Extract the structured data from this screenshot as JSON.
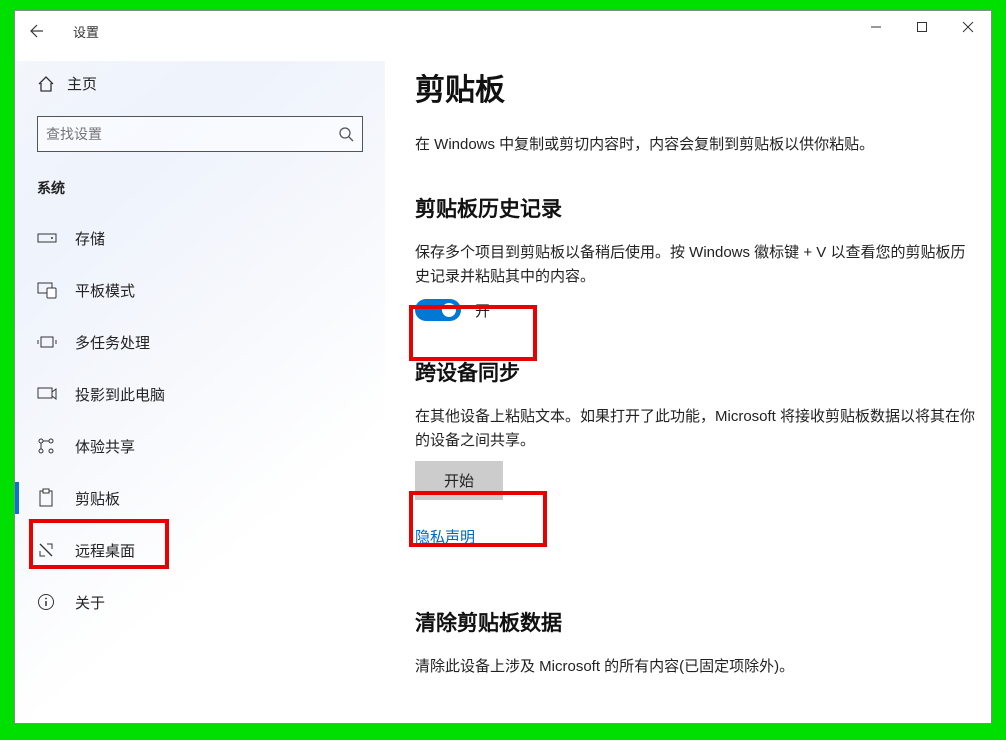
{
  "window": {
    "title": "设置"
  },
  "sidebar": {
    "home": "主页",
    "search_placeholder": "查找设置",
    "category": "系统",
    "items": [
      {
        "label": "存储"
      },
      {
        "label": "平板模式"
      },
      {
        "label": "多任务处理"
      },
      {
        "label": "投影到此电脑"
      },
      {
        "label": "体验共享"
      },
      {
        "label": "剪贴板",
        "selected": true
      },
      {
        "label": "远程桌面"
      },
      {
        "label": "关于"
      }
    ]
  },
  "main": {
    "title": "剪贴板",
    "intro": "在 Windows 中复制或剪切内容时，内容会复制到剪贴板以供你粘贴。",
    "section1": {
      "title": "剪贴板历史记录",
      "desc": "保存多个项目到剪贴板以备稍后使用。按 Windows 徽标键 + V 以查看您的剪贴板历史记录并粘贴其中的内容。",
      "toggle_state": "开",
      "toggle_on": true
    },
    "section2": {
      "title": "跨设备同步",
      "desc": "在其他设备上粘贴文本。如果打开了此功能，Microsoft 将接收剪贴板数据以将其在你的设备之间共享。",
      "button": "开始",
      "link": "隐私声明"
    },
    "section3": {
      "title": "清除剪贴板数据",
      "desc": "清除此设备上涉及 Microsoft 的所有内容(已固定项除外)。"
    }
  }
}
